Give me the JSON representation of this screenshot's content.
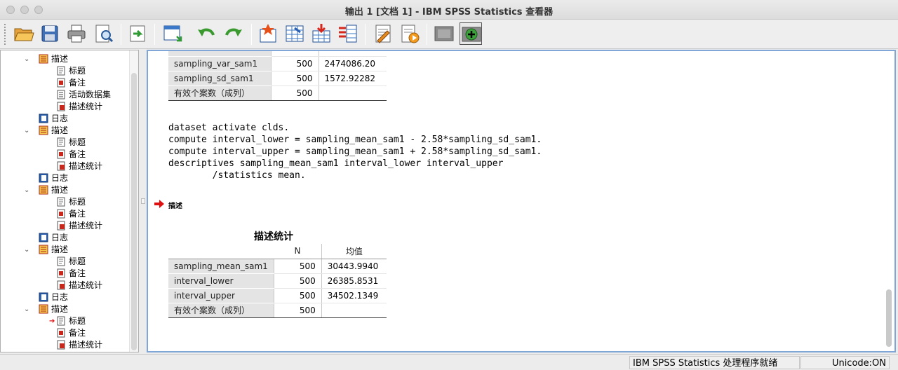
{
  "window": {
    "title": "输出 1 [文档 1] - IBM SPSS Statistics 查看器"
  },
  "toolbar": {
    "buttons": [
      "open-icon",
      "save-icon",
      "print-icon",
      "print-preview-icon",
      "export-icon",
      "goto-data-icon",
      "undo-icon",
      "redo-icon",
      "goto-case-icon",
      "goto-variable-icon",
      "insert-cases-icon",
      "variables-icon",
      "designate-window-icon",
      "run-icon",
      "hide-icon",
      "show-icon"
    ]
  },
  "outline": {
    "items": [
      {
        "label": "描述",
        "type": "folder",
        "level": 1,
        "expanded": true
      },
      {
        "label": "标题",
        "type": "title",
        "level": 2
      },
      {
        "label": "备注",
        "type": "notes",
        "level": 2
      },
      {
        "label": "活动数据集",
        "type": "dataset",
        "level": 2
      },
      {
        "label": "描述统计",
        "type": "table",
        "level": 2
      },
      {
        "label": "日志",
        "type": "log",
        "level": 1
      },
      {
        "label": "描述",
        "type": "folder",
        "level": 1,
        "expanded": true
      },
      {
        "label": "标题",
        "type": "title",
        "level": 2
      },
      {
        "label": "备注",
        "type": "notes",
        "level": 2
      },
      {
        "label": "描述统计",
        "type": "table",
        "level": 2
      },
      {
        "label": "日志",
        "type": "log",
        "level": 1
      },
      {
        "label": "描述",
        "type": "folder",
        "level": 1,
        "expanded": true
      },
      {
        "label": "标题",
        "type": "title",
        "level": 2
      },
      {
        "label": "备注",
        "type": "notes",
        "level": 2
      },
      {
        "label": "描述统计",
        "type": "table",
        "level": 2
      },
      {
        "label": "日志",
        "type": "log",
        "level": 1
      },
      {
        "label": "描述",
        "type": "folder",
        "level": 1,
        "expanded": true
      },
      {
        "label": "标题",
        "type": "title",
        "level": 2
      },
      {
        "label": "备注",
        "type": "notes",
        "level": 2
      },
      {
        "label": "描述统计",
        "type": "table",
        "level": 2
      },
      {
        "label": "日志",
        "type": "log",
        "level": 1
      },
      {
        "label": "描述",
        "type": "folder",
        "level": 1,
        "expanded": true
      },
      {
        "label": "标题",
        "type": "title",
        "level": 2,
        "current": true
      },
      {
        "label": "备注",
        "type": "notes",
        "level": 2
      },
      {
        "label": "描述统计",
        "type": "table",
        "level": 2
      }
    ]
  },
  "top_table": {
    "rows": [
      {
        "label": "sampling_var_sam1",
        "n": "500",
        "value": "2474086.20"
      },
      {
        "label": "sampling_sd_sam1",
        "n": "500",
        "value": "1572.92282"
      },
      {
        "label": "有效个案数（成列）",
        "n": "500",
        "value": ""
      }
    ]
  },
  "syntax": {
    "lines": [
      "dataset activate clds.",
      "compute interval_lower = sampling_mean_sam1 - 2.58*sampling_sd_sam1.",
      "compute interval_upper = sampling_mean_sam1 + 2.58*sampling_sd_sam1.",
      "descriptives sampling_mean_sam1 interval_lower interval_upper",
      "        /statistics mean."
    ]
  },
  "section": {
    "title": "描述"
  },
  "desc_table": {
    "title": "描述统计",
    "headers": [
      "N",
      "均值"
    ],
    "rows": [
      {
        "label": "sampling_mean_sam1",
        "n": "500",
        "mean": "30443.9940"
      },
      {
        "label": "interval_lower",
        "n": "500",
        "mean": "26385.8531"
      },
      {
        "label": "interval_upper",
        "n": "500",
        "mean": "34502.1349"
      },
      {
        "label": "有效个案数（成列）",
        "n": "500",
        "mean": ""
      }
    ]
  },
  "status": {
    "processor": "IBM SPSS Statistics 处理程序就绪",
    "unicode": "Unicode:ON"
  },
  "colors": {
    "accent": "#7fa6d6",
    "label_bg": "#e4e4e4",
    "marker": "#e01010"
  }
}
